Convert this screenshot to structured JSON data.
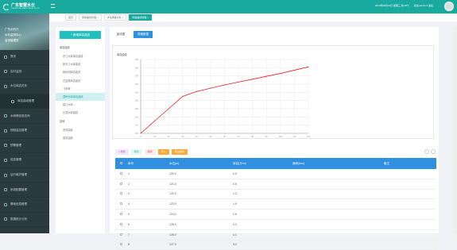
{
  "app": {
    "name": "广东智慧水云",
    "subtitle": "GUANGDONG SMART WATER CLOUD"
  },
  "user": {
    "lines": [
      "广东水利厅",
      "水利监测中心",
      "监测管理员"
    ]
  },
  "sidebar": {
    "items": [
      {
        "label": "首页",
        "icon": "home-icon"
      },
      {
        "label": "实时监测",
        "icon": "monitor-icon"
      },
      {
        "label": "水位库容关系",
        "icon": "chart-icon"
      },
      {
        "label": "库容曲线管理",
        "icon": "curve-icon",
        "sub": true
      },
      {
        "label": "水雨情信息查询",
        "icon": "rain-icon"
      },
      {
        "label": "视频监控管理",
        "icon": "video-icon"
      },
      {
        "label": "预警管理",
        "icon": "alert-icon"
      },
      {
        "label": "巡查管理",
        "icon": "patrol-icon"
      },
      {
        "label": "运行维护管理",
        "icon": "maintain-icon"
      },
      {
        "label": "系统配置管理",
        "icon": "settings-icon"
      },
      {
        "label": "基础信息管理",
        "icon": "info-icon"
      },
      {
        "label": "数据统计分析",
        "icon": "stats-icon"
      }
    ]
  },
  "topbar": {
    "info": "2019年08月14日 星期三 晴 28℃",
    "user": "欢迎 admin ▾ 退出"
  },
  "tabs": [
    "首页",
    "库容曲线管理 ×",
    "水位库容关系 ×",
    "库容曲线管理 ×"
  ],
  "left": {
    "button": "+ 新增库容曲线",
    "group1": "库容曲线",
    "items": [
      "东江水库库容曲线",
      "新丰江水库曲线",
      "枫树坝库容曲线",
      "白盆珠库容曲线",
      "飞来峡",
      "潭岭水库库容曲线",
      "锦江水库",
      "长潭水库曲线"
    ],
    "active": 5,
    "group2": "其他",
    "items2": [
      "泄洪曲线",
      "蒸发曲线"
    ]
  },
  "view": {
    "tabs": [
      "曲线图",
      "表格数据"
    ],
    "active": 1
  },
  "chart_data": {
    "type": "line",
    "title": "库容曲线",
    "x": [
      0,
      10,
      20,
      30,
      40,
      50,
      60,
      70,
      80,
      90,
      100,
      110,
      120
    ],
    "values": [
      120,
      123,
      126,
      129,
      130.2,
      131,
      131.8,
      132.5,
      133.2,
      133.9,
      134.6,
      135.4,
      136.2
    ],
    "ylim": [
      120,
      138
    ],
    "xlim": [
      0,
      120
    ],
    "y_ticks": [
      120,
      122,
      124,
      126,
      128,
      130,
      132,
      134,
      136,
      138
    ],
    "x_ticks": [
      0,
      10,
      20,
      30,
      40,
      50,
      60,
      70,
      80,
      90,
      100,
      110,
      120
    ],
    "color": "#e02020",
    "grid": true
  },
  "toolbar": [
    {
      "label": "+ 新增",
      "bg": "#f3e8fb",
      "fg": "#a04cc0"
    },
    {
      "label": "修改",
      "bg": "#e7f7f3",
      "fg": "#1aa99f"
    },
    {
      "label": "删除",
      "bg": "#fdecef",
      "fg": "#e04c6c"
    },
    {
      "label": "导入",
      "bg": "#f7a93a",
      "fg": "#fff"
    },
    {
      "label": "导出数据",
      "bg": "#f7a93a",
      "fg": "#fff"
    }
  ],
  "table": {
    "headers": [
      "",
      "序号",
      "水位(m)",
      "库容(万m³)",
      "面积(km²)",
      "备注"
    ],
    "rows": [
      [
        "",
        "1",
        "120.0",
        "0.0",
        "",
        ""
      ],
      [
        "",
        "2",
        "121.0",
        "0.5",
        "",
        ""
      ],
      [
        "",
        "3",
        "122.0",
        "1.2",
        "",
        ""
      ],
      [
        "",
        "4",
        "123.0",
        "1.9",
        "",
        ""
      ],
      [
        "",
        "5",
        "124.0",
        "2.6",
        "",
        ""
      ],
      [
        "",
        "6",
        "125.0",
        "3.3",
        "",
        ""
      ],
      [
        "",
        "7",
        "126.0",
        "4.1",
        "",
        ""
      ],
      [
        "",
        "8",
        "127.0",
        "5.0",
        "",
        ""
      ]
    ]
  }
}
